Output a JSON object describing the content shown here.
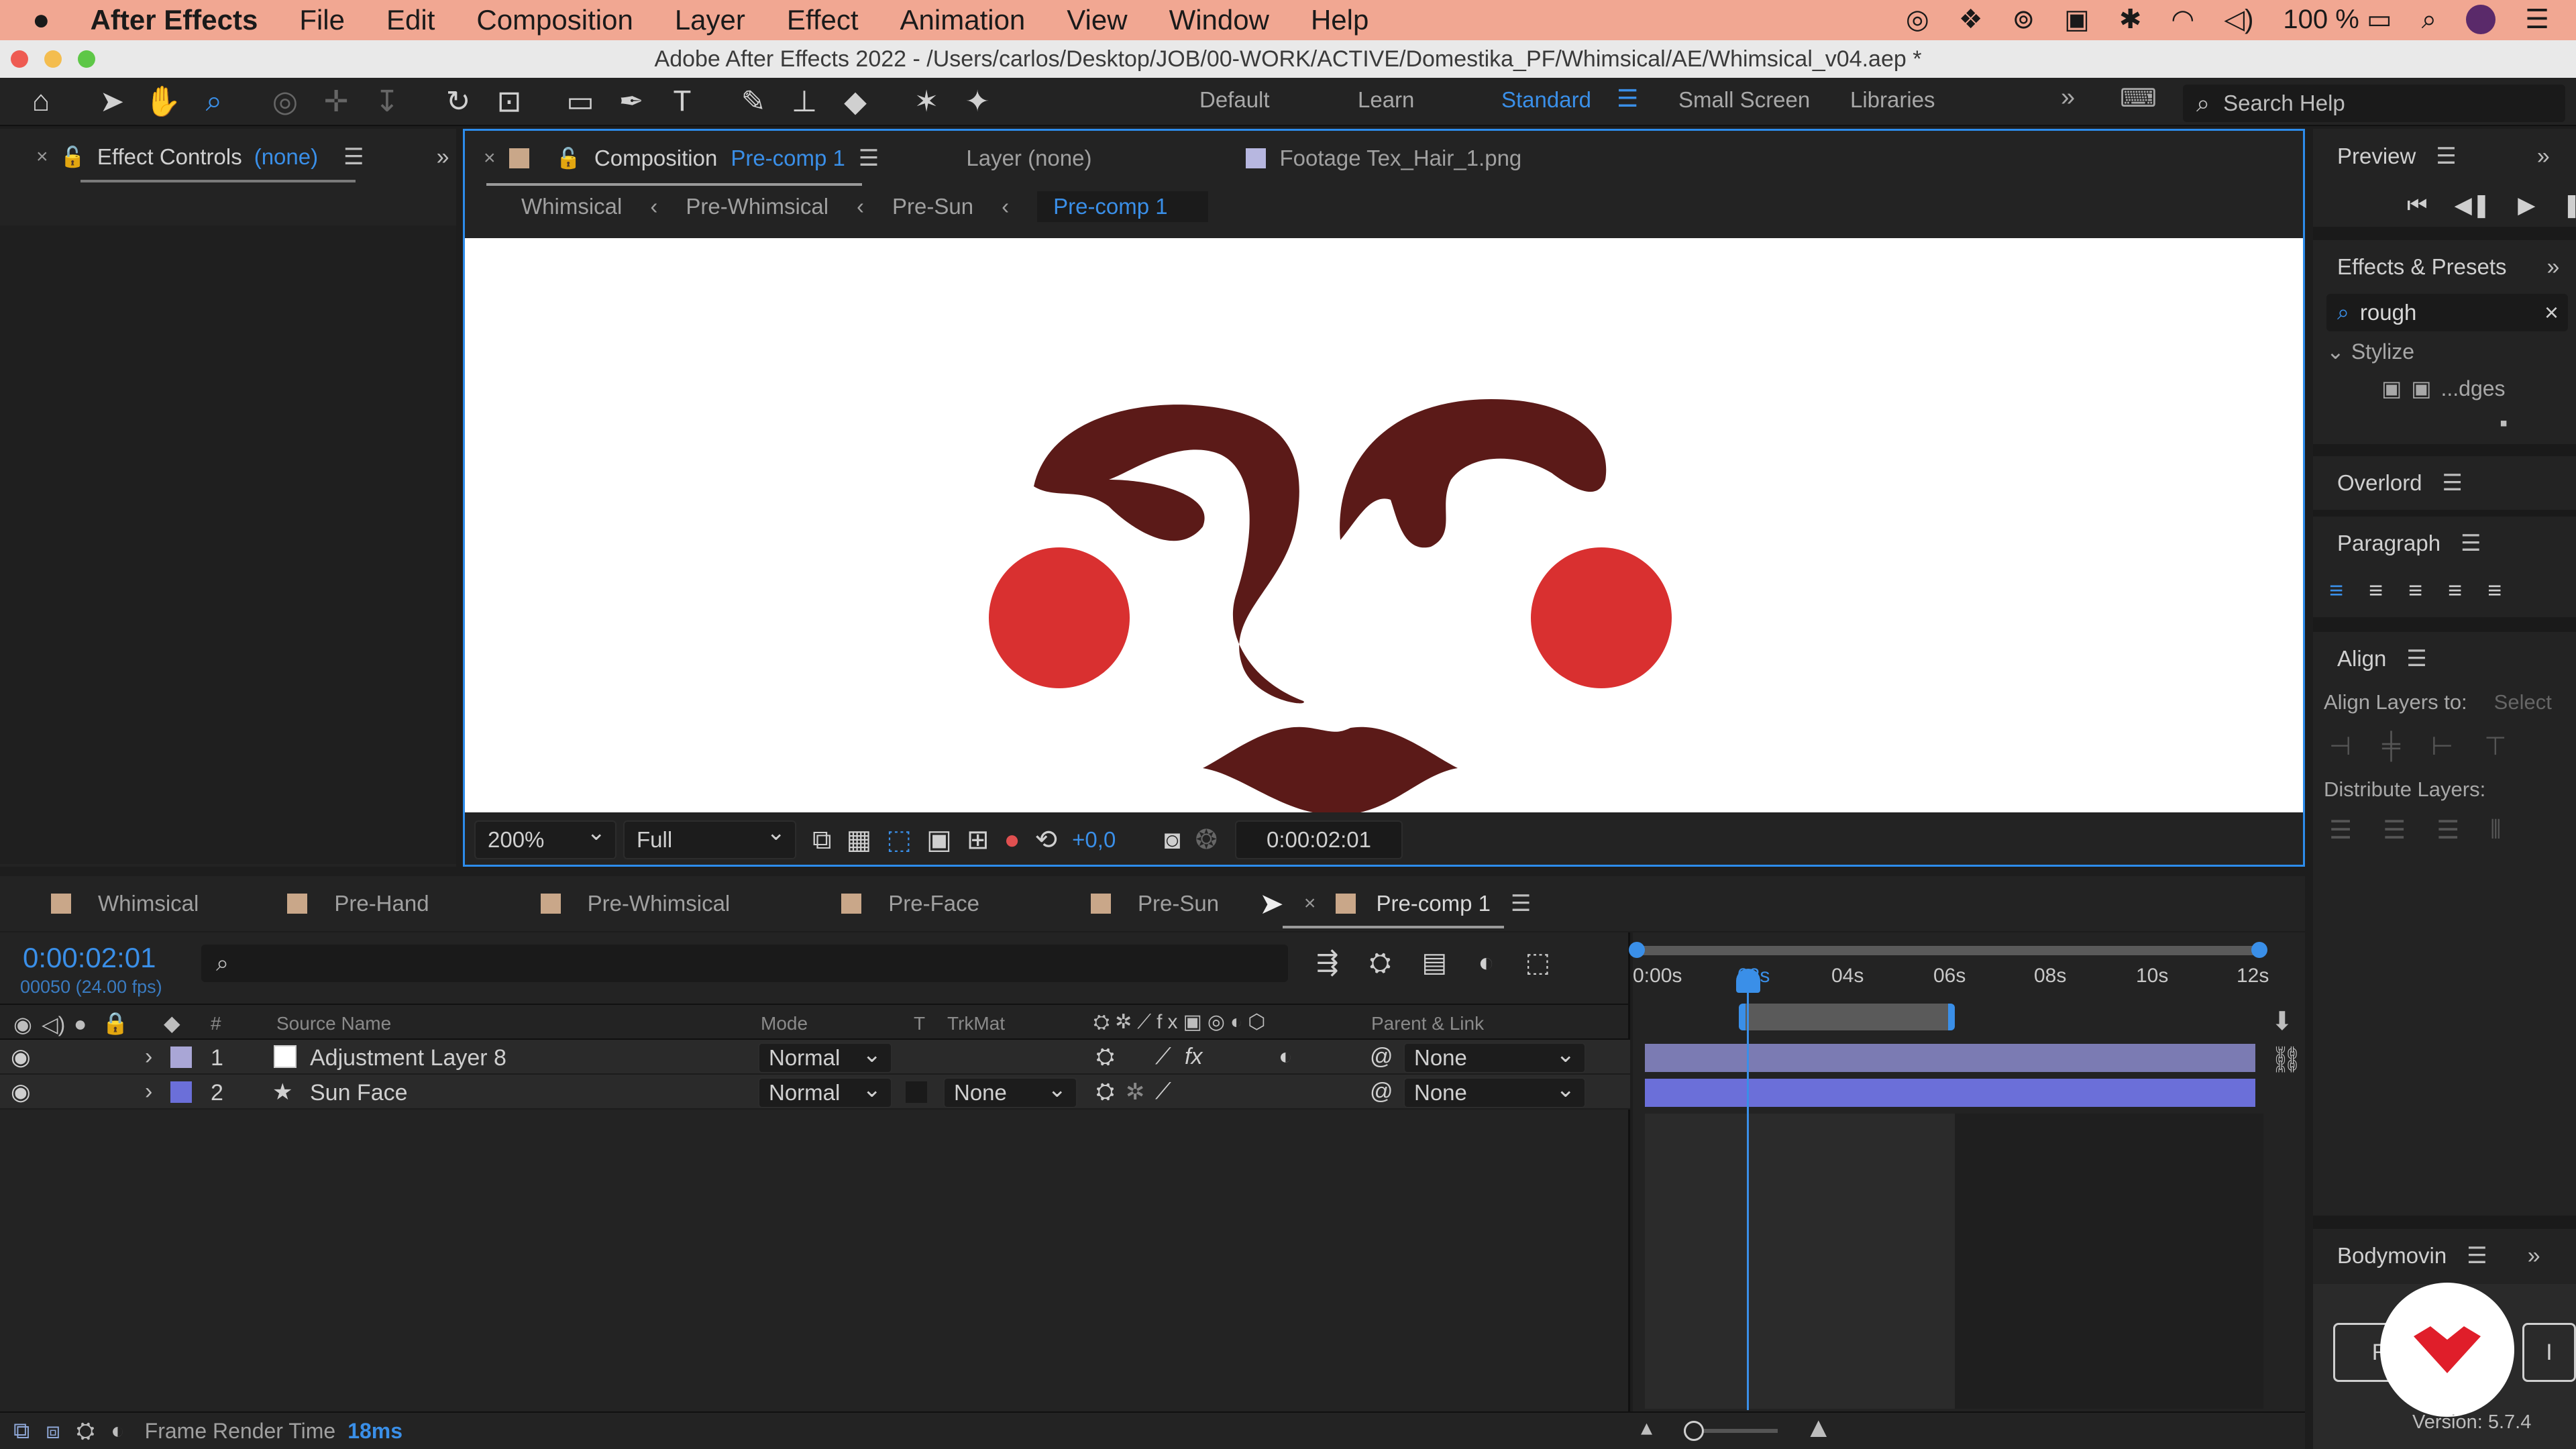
{
  "menubar": {
    "app": "After Effects",
    "items": [
      "File",
      "Edit",
      "Composition",
      "Layer",
      "Effect",
      "Animation",
      "View",
      "Window",
      "Help"
    ],
    "battery": "100 %"
  },
  "window": {
    "title": "Adobe After Effects 2022 - /Users/carlos/Desktop/JOB/00-WORK/ACTIVE/Domestika_PF/Whimsical/AE/Whimsical_v04.aep *"
  },
  "workspaces": [
    "Default",
    "Learn",
    "Standard",
    "Small Screen",
    "Libraries"
  ],
  "active_workspace": "Standard",
  "search_help": {
    "placeholder": "Search Help"
  },
  "effect_controls": {
    "label": "Effect Controls",
    "target": "(none)"
  },
  "viewer": {
    "tabs": {
      "composition_label": "Composition",
      "composition_name": "Pre-comp 1",
      "layer": "Layer (none)",
      "footage": "Footage Tex_Hair_1.png"
    },
    "breadcrumbs": [
      "Whimsical",
      "Pre-Whimsical",
      "Pre-Sun",
      "Pre-comp 1"
    ],
    "zoom": "200%",
    "resolution": "Full",
    "exposure": "+0,0",
    "timecode": "0:00:02:01"
  },
  "right_panels": {
    "preview": "Preview",
    "effects_presets": "Effects & Presets",
    "search_value": "rough",
    "category": "Stylize",
    "effect_item": "...dges",
    "overlord": "Overlord",
    "paragraph": "Paragraph",
    "align": "Align",
    "align_layers_to": "Align Layers to:",
    "align_select": "Select",
    "distribute": "Distribute Layers:",
    "bodymovin": "Bodymovin",
    "bodymovin_btn1": "R",
    "bodymovin_btn2": "I",
    "version": "Version: 5.7.4"
  },
  "timeline": {
    "tabs": [
      "Whimsical",
      "Pre-Hand",
      "Pre-Whimsical",
      "Pre-Face",
      "Pre-Sun",
      "Pre-comp 1"
    ],
    "current_time": "0:00:02:01",
    "frame_info": "00050 (24.00 fps)",
    "columns": {
      "num": "#",
      "source": "Source Name",
      "mode": "Mode",
      "t": "T",
      "trkmat": "TrkMat",
      "parent": "Parent & Link"
    },
    "layers": [
      {
        "num": "1",
        "name": "Adjustment Layer 8",
        "mode": "Normal",
        "trkmat": "",
        "parent": "None",
        "label_color": "#a9a6d6"
      },
      {
        "num": "2",
        "name": "Sun Face",
        "mode": "Normal",
        "trkmat": "None",
        "parent": "None",
        "label_color": "#6b6fd9"
      }
    ],
    "ruler": [
      "0:00s",
      "02s",
      "04s",
      "06s",
      "08s",
      "10s",
      "12s"
    ],
    "status_label": "Frame Render Time",
    "status_value": "18ms"
  },
  "colors": {
    "accent": "#3a8fe8",
    "face": "#5b1a18",
    "cheek": "#d93030",
    "layer_bar": "#7b7bb3"
  }
}
